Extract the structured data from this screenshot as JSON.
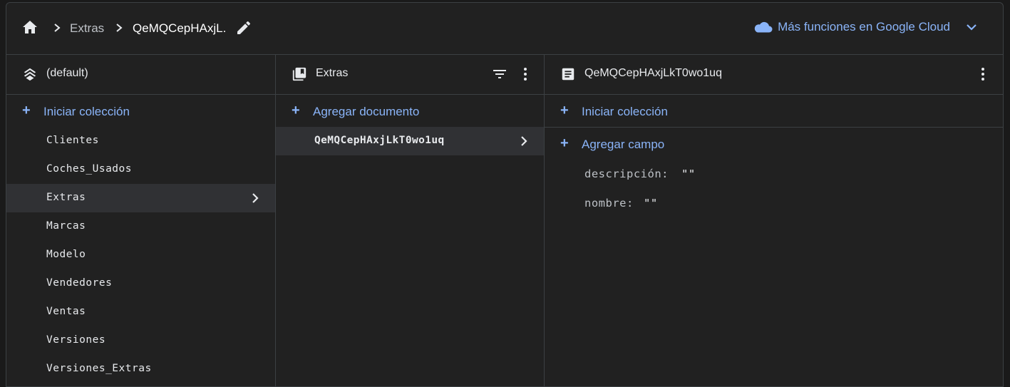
{
  "breadcrumb": {
    "items": [
      "Extras",
      "QeMQCepHAxjL."
    ],
    "home_icon": "home-icon",
    "edit_icon": "pencil-icon"
  },
  "cloud_link": {
    "label": "Más funciones en Google Cloud",
    "icon": "cloud-icon"
  },
  "database_panel": {
    "header": "(default)",
    "icon": "stacked-layers-icon",
    "action_label": "Iniciar colección",
    "collections": [
      "Clientes",
      "Coches_Usados",
      "Extras",
      "Marcas",
      "Modelo",
      "Vendedores",
      "Ventas",
      "Versiones",
      "Versiones_Extras"
    ],
    "selected": "Extras"
  },
  "collection_panel": {
    "header": "Extras",
    "icon": "collection-icon",
    "action_label": "Agregar documento",
    "documents": [
      "QeMQCepHAxjLkT0wo1uq"
    ],
    "selected": "QeMQCepHAxjLkT0wo1uq"
  },
  "document_panel": {
    "header": "QeMQCepHAxjLkT0wo1uq",
    "icon": "document-icon",
    "subcollection_action": "Iniciar colección",
    "field_action": "Agregar campo",
    "fields": [
      {
        "name": "descripción:",
        "value": "\"\""
      },
      {
        "name": "nombre:",
        "value": "\"\""
      }
    ]
  },
  "colors": {
    "accent": "#8ab4f8",
    "background": "#212121",
    "selected_row": "#303134",
    "border": "#3c4043"
  }
}
